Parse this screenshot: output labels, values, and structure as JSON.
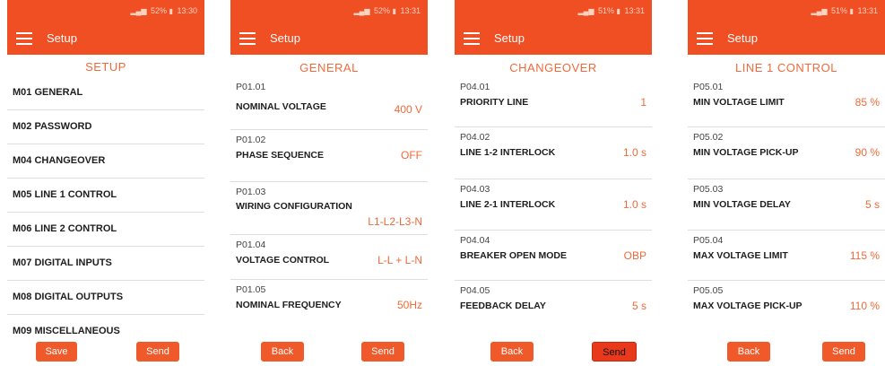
{
  "status_times": [
    "13:30",
    "13:31",
    "13:31",
    "13:31"
  ],
  "status_battery": [
    "52%",
    "52%",
    "51%",
    "51%"
  ],
  "app_title": "Setup",
  "accent_color": "#f04e23",
  "screens": [
    {
      "title": "SETUP",
      "items": [
        "M01 GENERAL",
        "M02 PASSWORD",
        "M04 CHANGEOVER",
        "M05 LINE 1 CONTROL",
        "M06 LINE 2 CONTROL",
        "M07 DIGITAL INPUTS",
        "M08 DIGITAL OUTPUTS",
        "M09 MISCELLANEOUS"
      ],
      "buttons": [
        "Save",
        "Send"
      ]
    },
    {
      "title": "GENERAL",
      "params": [
        {
          "code": "P01.01",
          "name": "NOMINAL VOLTAGE",
          "value": "400 V"
        },
        {
          "code": "P01.02",
          "name": "PHASE SEQUENCE",
          "value": "OFF"
        },
        {
          "code": "P01.03",
          "name": "WIRING CONFIGURATION",
          "value": "L1-L2-L3-N"
        },
        {
          "code": "P01.04",
          "name": "VOLTAGE CONTROL",
          "value": "L-L + L-N"
        },
        {
          "code": "P01.05",
          "name": "NOMINAL FREQUENCY",
          "value": "50Hz"
        }
      ],
      "buttons": [
        "Back",
        "Send"
      ]
    },
    {
      "title": "CHANGEOVER",
      "params": [
        {
          "code": "P04.01",
          "name": "PRIORITY LINE",
          "value": "1"
        },
        {
          "code": "P04.02",
          "name": "LINE 1-2 INTERLOCK",
          "value": "1.0 s"
        },
        {
          "code": "P04.03",
          "name": "LINE 2-1 INTERLOCK",
          "value": "1.0 s"
        },
        {
          "code": "P04.04",
          "name": "BREAKER OPEN MODE",
          "value": "OBP"
        },
        {
          "code": "P04.05",
          "name": "FEEDBACK DELAY",
          "value": "5 s"
        }
      ],
      "buttons": [
        "Back",
        "Send"
      ]
    },
    {
      "title": "LINE 1 CONTROL",
      "params": [
        {
          "code": "P05.01",
          "name": "MIN VOLTAGE LIMIT",
          "value": "85 %"
        },
        {
          "code": "P05.02",
          "name": "MIN VOLTAGE PICK-UP",
          "value": "90 %"
        },
        {
          "code": "P05.03",
          "name": "MIN VOLTAGE DELAY",
          "value": "5 s"
        },
        {
          "code": "P05.04",
          "name": "MAX VOLTAGE LIMIT",
          "value": "115 %"
        },
        {
          "code": "P05.05",
          "name": "MAX VOLTAGE PICK-UP",
          "value": "110 %"
        }
      ],
      "buttons": [
        "Back",
        "Send"
      ]
    }
  ]
}
